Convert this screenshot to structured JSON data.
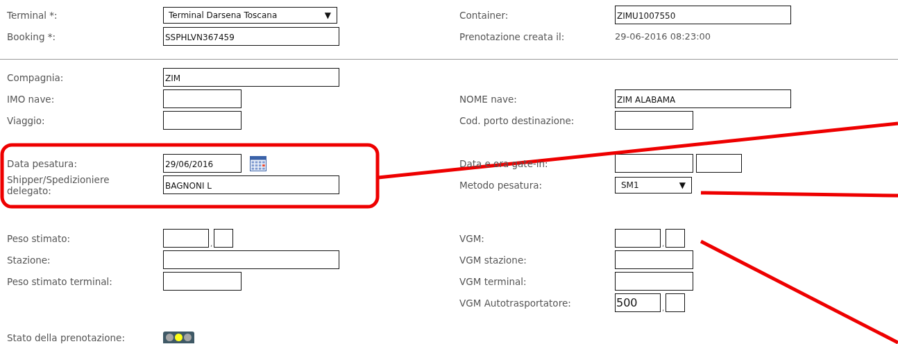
{
  "sections": [
    {
      "divider": true,
      "rows": [
        {
          "left": {
            "label": "Terminal *:",
            "field": {
              "kind": "dropdown",
              "value": "Terminal Darsena Toscana",
              "arrow": "▼"
            }
          },
          "right": {
            "label": "Container:",
            "field": {
              "kind": "textbox",
              "value": "ZIMU1007550"
            }
          }
        },
        {
          "left": {
            "label": "Booking *:",
            "field": {
              "kind": "textbox",
              "value": "SSPHLVN367459"
            }
          },
          "right": {
            "label": "Prenotazione creata il:",
            "field": {
              "kind": "readonly",
              "value": "29-06-2016 08:23:00"
            }
          }
        }
      ]
    },
    {
      "rows": [
        {
          "left": {
            "label": "Compagnia:",
            "field": {
              "kind": "textbox",
              "value": "ZIM"
            }
          }
        },
        {
          "left": {
            "label": "IMO nave:",
            "field": {
              "kind": "shortbox"
            }
          },
          "right": {
            "label": "NOME nave:",
            "field": {
              "kind": "textbox",
              "value": "ZIM ALABAMA"
            }
          }
        },
        {
          "left": {
            "label": "Viaggio:",
            "field": {
              "kind": "shortbox"
            }
          },
          "right": {
            "label": "Cod. porto destinazione:",
            "field": {
              "kind": "shortbox"
            }
          }
        }
      ]
    },
    {
      "rows": [
        {
          "left": {
            "label": "Data pesatura:",
            "field": {
              "kind": "date",
              "value": "29/06/2016"
            }
          },
          "right": {
            "label": "Data e ora gate-in:",
            "field": {
              "kind": "pair"
            }
          }
        },
        {
          "left": {
            "label": "Shipper/Spedizioniere delegato:",
            "field": {
              "kind": "textbox",
              "value": "BAGNONI L"
            }
          },
          "right": {
            "label": "Metodo pesatura:",
            "field": {
              "kind": "shortdropdown",
              "value": "SM1",
              "arrow": "▼"
            }
          }
        }
      ]
    },
    {
      "rows": [
        {
          "left": {
            "label": "Peso stimato:",
            "field": {
              "kind": "split",
              "separator": ","
            }
          },
          "right": {
            "label": "VGM:",
            "field": {
              "kind": "split",
              "separator": ","
            }
          }
        },
        {
          "left": {
            "label": "Stazione:",
            "field": {
              "kind": "textbox"
            }
          },
          "right": {
            "label": "VGM stazione:",
            "field": {
              "kind": "shortbox"
            }
          }
        },
        {
          "left": {
            "label": "Peso stimato terminal:",
            "field": {
              "kind": "shortbox"
            }
          },
          "right": {
            "label": "VGM terminal:",
            "field": {
              "kind": "shortbox"
            }
          }
        },
        {
          "right": {
            "label": "VGM Autotrasportatore:",
            "field": {
              "kind": "split",
              "value": "500",
              "separator": ","
            }
          }
        }
      ]
    },
    {
      "rows": [
        {
          "left": {
            "label": "Stato della prenotazione:",
            "field": {
              "kind": "status",
              "lights": [
                {
                  "color": "#a6a6a6"
                },
                {
                  "color": "#ffff1a"
                },
                {
                  "color": "#a6a6a6"
                }
              ]
            }
          }
        }
      ]
    }
  ],
  "annotations": [
    {
      "kind": "box"
    },
    {
      "kind": "line"
    },
    {
      "kind": "line"
    },
    {
      "kind": "line"
    }
  ]
}
